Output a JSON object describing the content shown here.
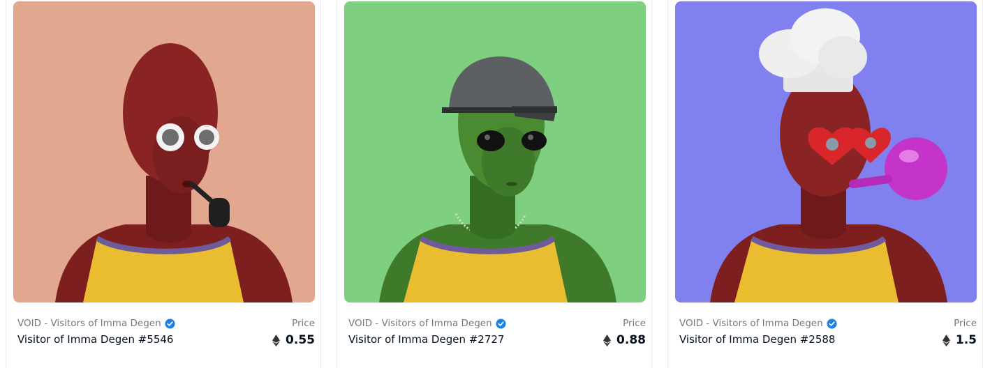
{
  "cards": [
    {
      "collection": "VOID - Visitors of Imma Degen",
      "name": "Visitor of Imma Degen #5546",
      "price_label": "Price",
      "price": "0.55",
      "bg_color": "#e2a78f",
      "skin_color": "#7e1f1f",
      "accessory": "pipe"
    },
    {
      "collection": "VOID - Visitors of Imma Degen",
      "name": "Visitor of Imma Degen #2727",
      "price_label": "Price",
      "price": "0.88",
      "bg_color": "#7ecf7f",
      "skin_color": "#3f7a2a",
      "accessory": "helmet"
    },
    {
      "collection": "VOID - Visitors of Imma Degen",
      "name": "Visitor of Imma Degen #2588",
      "price_label": "Price",
      "price": "1.5",
      "bg_color": "#8080ee",
      "skin_color": "#7e1f1f",
      "accessory": "chef-hat"
    }
  ],
  "icons": {
    "verified": "verified-badge-icon",
    "currency": "ethereum-icon"
  },
  "colors": {
    "verified_blue": "#2081e2",
    "muted_text": "#707a83",
    "jersey_yellow": "#e9bd2f",
    "jersey_trim": "#6f5a9c"
  }
}
